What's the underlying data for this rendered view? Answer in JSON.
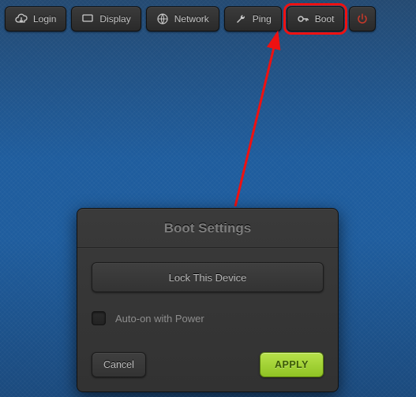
{
  "toolbar": {
    "login": "Login",
    "display": "Display",
    "network": "Network",
    "ping": "Ping",
    "boot": "Boot"
  },
  "modal": {
    "title": "Boot Settings",
    "lock_label": "Lock This Device",
    "auto_on_label": "Auto-on with Power",
    "cancel": "Cancel",
    "apply": "APPLY"
  }
}
